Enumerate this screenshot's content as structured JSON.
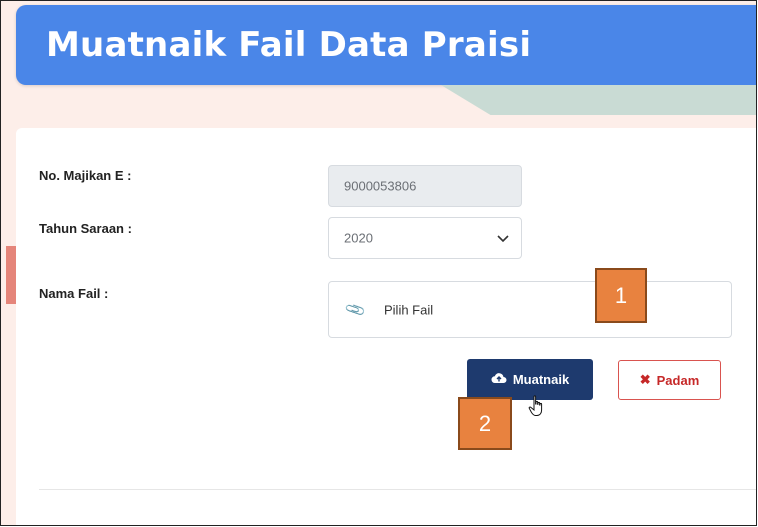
{
  "header": {
    "title": "Muatnaik Fail Data Praisi"
  },
  "form": {
    "employer_no": {
      "label": "No. Majikan E :",
      "value": "9000053806"
    },
    "year": {
      "label": "Tahun Saraan :",
      "value": "2020"
    },
    "file": {
      "label": "Nama Fail :",
      "placeholder": "Pilih Fail"
    }
  },
  "buttons": {
    "upload": "Muatnaik",
    "cancel": "Padam"
  },
  "callouts": {
    "one": "1",
    "two": "2"
  },
  "colors": {
    "header": "#4a86e8",
    "upload_button": "#1e3a6e",
    "cancel_text": "#c62828",
    "callout": "#e8823f"
  }
}
